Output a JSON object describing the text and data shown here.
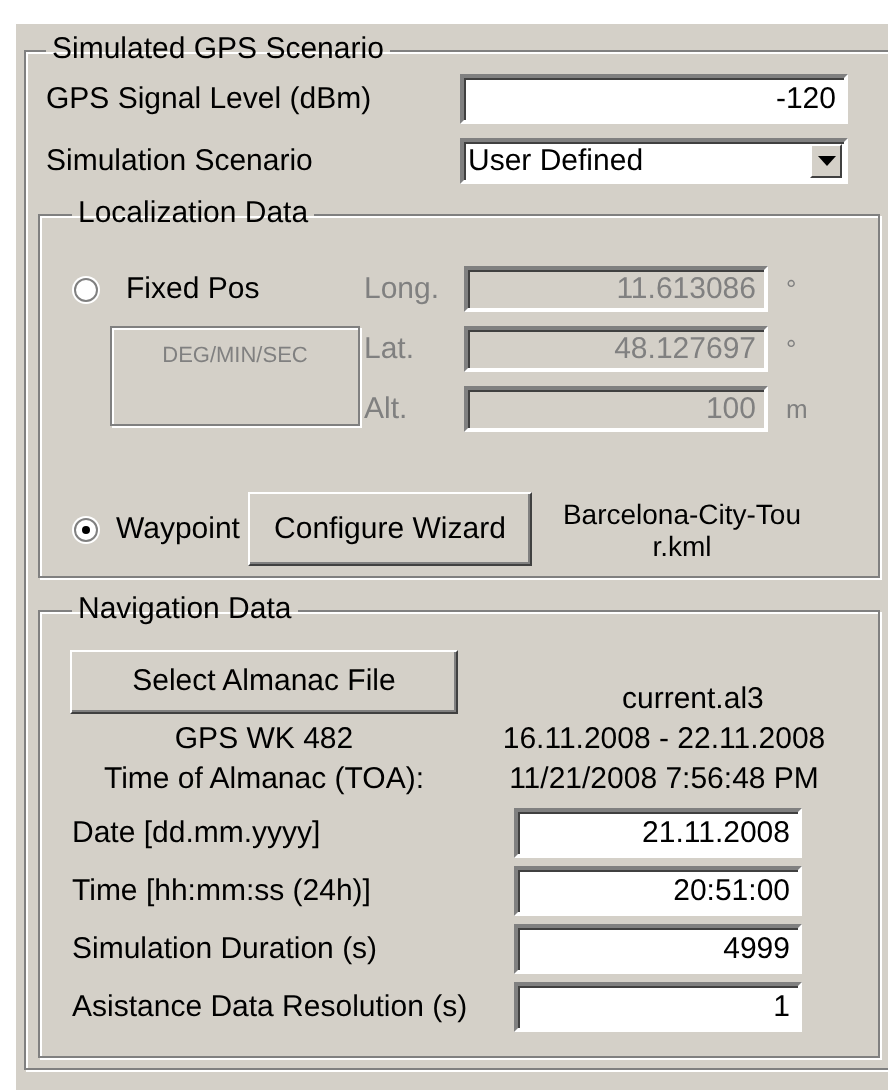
{
  "scenario": {
    "title": "Simulated GPS Scenario",
    "fields": [
      {
        "kind": "text",
        "label": "GPS Signal Level (dBm)",
        "value": "-120"
      },
      {
        "kind": "dropdown",
        "label": "Simulation Scenario",
        "value": "User Defined"
      }
    ]
  },
  "localization": {
    "title": "Localization Data",
    "modes": [
      {
        "label": "Fixed Pos",
        "selected": false
      },
      {
        "label": "Waypoint",
        "selected": true
      }
    ],
    "fixed_disabled": true,
    "format_button": "DEG/MIN/SEC",
    "coordinates": [
      {
        "label": "Long.",
        "value": "11.613086",
        "unit": "°"
      },
      {
        "label": "Lat.",
        "value": "48.127697",
        "unit": "°"
      },
      {
        "label": "Alt.",
        "value": "100",
        "unit": "m"
      }
    ],
    "wizard_button": "Configure Wizard",
    "waypoint_file": "Barcelona-City-Tour.kml"
  },
  "navigation": {
    "title": "Navigation Data",
    "almanac_button": "Select Almanac File",
    "almanac_file": "current.al3",
    "almanac_info": [
      {
        "label": "GPS WK 482",
        "value": "16.11.2008 - 22.11.2008"
      },
      {
        "label": "Time of Almanac (TOA):",
        "value": "11/21/2008 7:56:48 PM"
      }
    ],
    "fields": [
      {
        "label": "Date [dd.mm.yyyy]",
        "value": "21.11.2008"
      },
      {
        "label": "Time [hh:mm:ss (24h)]",
        "value": "20:51:00"
      },
      {
        "label": "Simulation Duration (s)",
        "value": "4999"
      },
      {
        "label": "Asistance Data Resolution (s)",
        "value": "1"
      }
    ]
  }
}
